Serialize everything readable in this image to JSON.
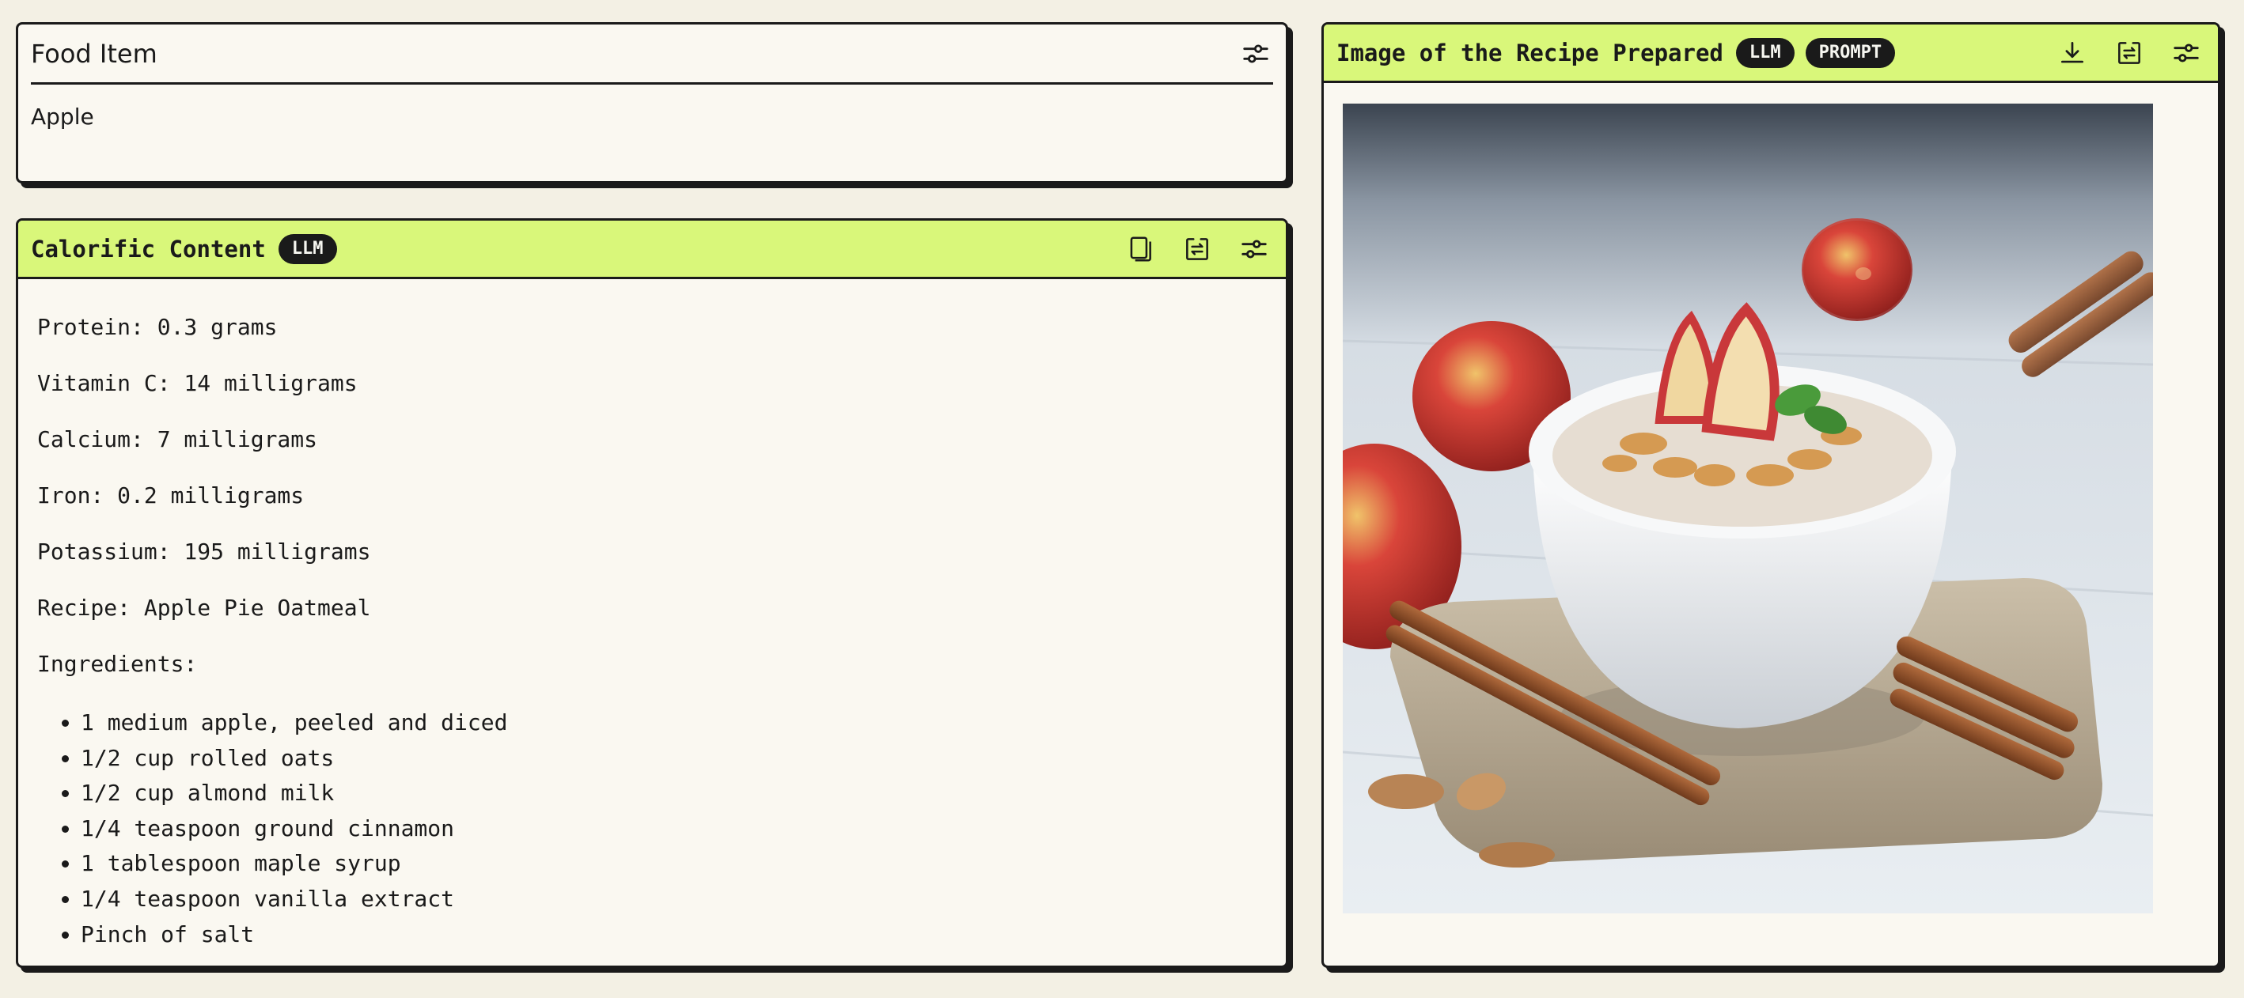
{
  "food_card": {
    "title": "Food Item",
    "value": "Apple",
    "icons": [
      "sliders-icon"
    ]
  },
  "calorific_card": {
    "title": "Calorific Content",
    "badge": "LLM",
    "icons": [
      "copy-icon",
      "swap-icon",
      "sliders-icon"
    ],
    "lines": [
      "Protein: 0.3 grams",
      "Vitamin C: 14 milligrams",
      "Calcium: 7 milligrams",
      "Iron: 0.2 milligrams",
      "Potassium: 195 milligrams",
      "Recipe: Apple Pie Oatmeal",
      "Ingredients:"
    ],
    "ingredients": [
      "1 medium apple, peeled and diced",
      "1/2 cup rolled oats",
      "1/2 cup almond milk",
      "1/4 teaspoon ground cinnamon",
      "1 tablespoon maple syrup",
      "1/4 teaspoon vanilla extract",
      "Pinch of salt"
    ]
  },
  "image_card": {
    "title": "Image of the Recipe Prepared",
    "badges": [
      "LLM",
      "PROMPT"
    ],
    "icons": [
      "download-icon",
      "swap-icon",
      "sliders-icon"
    ]
  },
  "colors": {
    "accent": "#d9f77a",
    "background": "#f3f0e4",
    "card": "#faf8f1",
    "ink": "#1a1a1a"
  }
}
